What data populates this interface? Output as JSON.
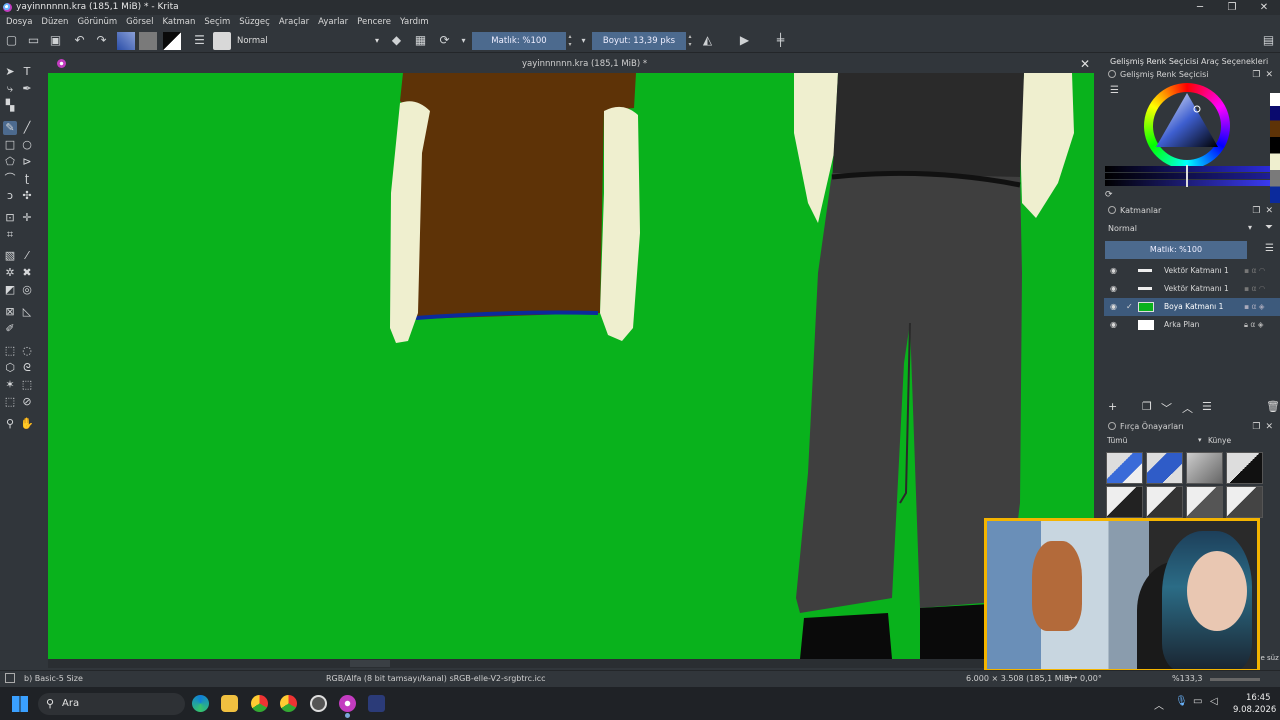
{
  "window": {
    "title": "yayinnnnnn.kra (185,1 MiB) * - Krita",
    "buttons": [
      "─",
      "❐",
      "✕"
    ]
  },
  "menu": [
    "Dosya",
    "Düzen",
    "Görünüm",
    "Görsel",
    "Katman",
    "Seçim",
    "Süzgeç",
    "Araçlar",
    "Ayarlar",
    "Pencere",
    "Yardım"
  ],
  "toolbar": {
    "blend_mode": "Normal",
    "opacity": "Matlık: %100",
    "size": "Boyut: 13,39 pks"
  },
  "document_tab": {
    "title": "yayinnnnnn.kra (185,1 MiB) *"
  },
  "dock": {
    "tabs": [
      "Gelişmiş Renk Seçicisi",
      "Araç Seçenekleri"
    ],
    "color_selector_title": "Gelişmiş Renk Seçicisi",
    "layers_title": "Katmanlar",
    "layers_blend": "Normal",
    "layers_opacity": "Matlık: %100",
    "layers": [
      {
        "name": "Vektör Katmanı 1",
        "selected": false
      },
      {
        "name": "Vektör Katmanı 1",
        "selected": false
      },
      {
        "name": "Boya Katmanı 1",
        "selected": true
      },
      {
        "name": "Arka Plan",
        "selected": false
      }
    ],
    "brush_presets_title": "Fırça Önayarları",
    "brush_filter": "Tümü",
    "brush_tag": "Künye",
    "brush_search_hint": "3e süz"
  },
  "status": {
    "brush": "b) Basic-5 Size",
    "color_profile": "RGB/Alfa (8 bit tamsayı/kanal) sRGB-elle-V2-srgbtrc.icc",
    "dimensions": "6.000 × 3.508 (185,1 MiB)",
    "rotation": "0,00°",
    "zoom": "%133,3"
  },
  "taskbar": {
    "search_placeholder": "Ara",
    "time": "16:45",
    "date": "9.08.2026"
  },
  "colors": {
    "canvas_bg": "#09b21c",
    "accent": "#4c6a8e",
    "shirt_brown": "#5e3307",
    "sleeve_cream": "#efefcf",
    "pants_gray": "#3f3f3f",
    "webcam_border": "#f4b400"
  }
}
